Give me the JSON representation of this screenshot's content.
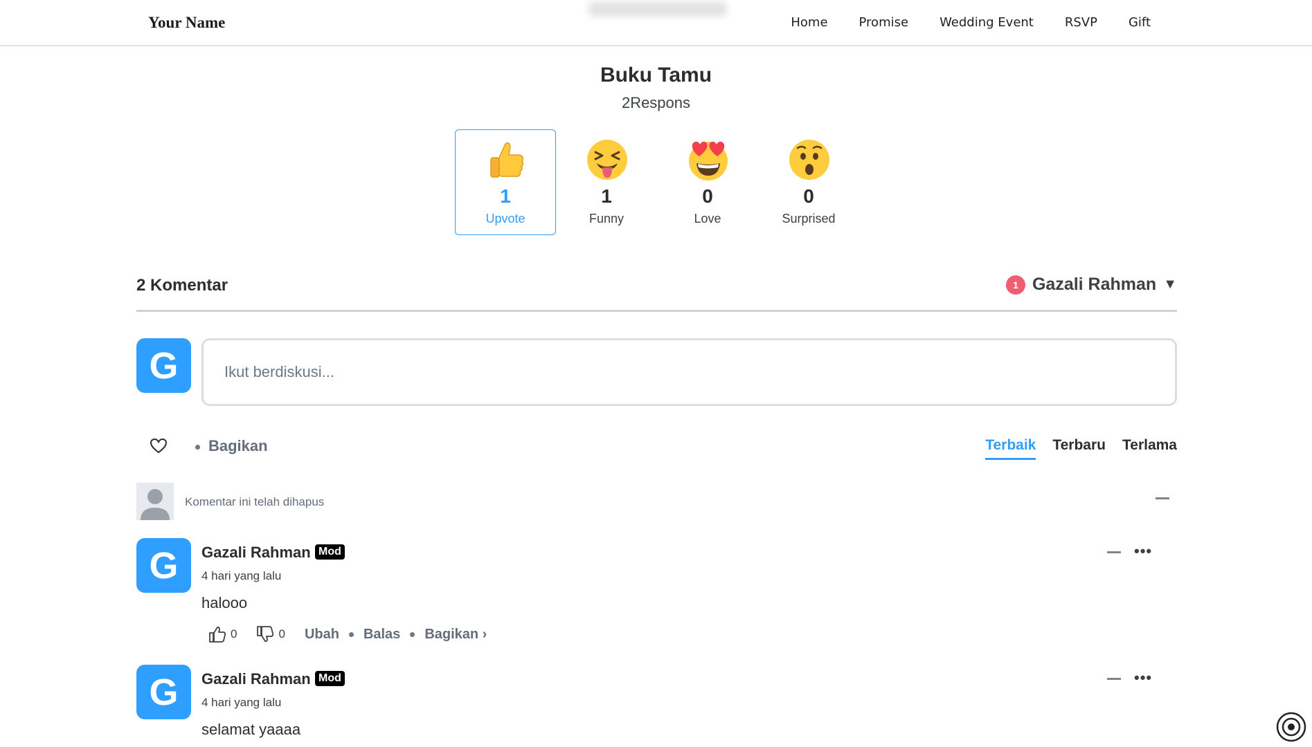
{
  "nav": {
    "brand": "Your Name",
    "links": [
      "Home",
      "Promise",
      "Wedding Event",
      "RSVP",
      "Gift"
    ]
  },
  "guestbook": {
    "title": "Buku Tamu",
    "response_count": "2Respons"
  },
  "reactions": [
    {
      "label": "Upvote",
      "count": "1",
      "icon": "thumbs-up-emoji",
      "selected": true
    },
    {
      "label": "Funny",
      "count": "1",
      "icon": "squinting-tongue-emoji",
      "selected": false
    },
    {
      "label": "Love",
      "count": "0",
      "icon": "heart-eyes-emoji",
      "selected": false
    },
    {
      "label": "Surprised",
      "count": "0",
      "icon": "astonished-emoji",
      "selected": false
    }
  ],
  "comments_header": {
    "count_label": "2 Komentar",
    "notification_count": "1",
    "user_name": "Gazali Rahman",
    "menu_icon": "caret-down-icon"
  },
  "composer": {
    "avatar_letter": "G",
    "placeholder": "Ikut berdiskusi..."
  },
  "toolbar": {
    "share_label": "Bagikan",
    "sort_tabs": [
      "Terbaik",
      "Terbaru",
      "Terlama"
    ],
    "active_sort": "Terbaik"
  },
  "deleted_comment": {
    "text": "Komentar ini telah dihapus"
  },
  "comments": [
    {
      "avatar_letter": "G",
      "author": "Gazali Rahman",
      "badge": "Mod",
      "time": "4 hari yang lalu",
      "body": "halooo",
      "upvotes": "0",
      "downvotes": "0",
      "actions": [
        "Ubah",
        "Balas",
        "Bagikan ›"
      ]
    },
    {
      "avatar_letter": "G",
      "author": "Gazali Rahman",
      "badge": "Mod",
      "time": "4 hari yang lalu",
      "body": "selamat yaaaa"
    }
  ],
  "colors": {
    "accent": "#2e9fff",
    "badge_red": "#f05f70",
    "text_dark": "#2a2e2e",
    "text_muted": "#656c7a"
  }
}
